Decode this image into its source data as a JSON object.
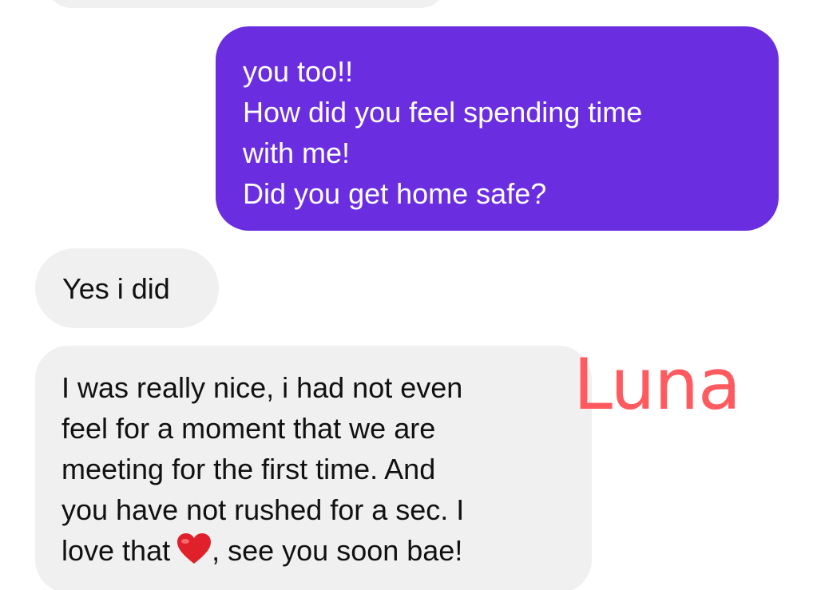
{
  "messages": [
    {
      "direction": "incoming",
      "lines": []
    },
    {
      "direction": "outgoing",
      "lines": [
        "you too!!",
        "How did you feel spending time",
        "with me!",
        "Did you get home safe?"
      ]
    },
    {
      "direction": "incoming",
      "lines": [
        "Yes i did"
      ]
    },
    {
      "direction": "incoming",
      "lines": [
        "I was really nice, i had not even",
        "feel for a moment that we are",
        "meeting for the first time. And",
        "you have not rushed for a sec. I",
        "love that",
        ", see you soon bae!"
      ],
      "emoji": "red-heart-emoji"
    }
  ],
  "watermark": "Luna",
  "colors": {
    "outgoing_bubble": "#6a2ee0",
    "incoming_bubble": "#f0f0f0",
    "watermark": "#ff5a5f",
    "heart": "#e0202a"
  }
}
